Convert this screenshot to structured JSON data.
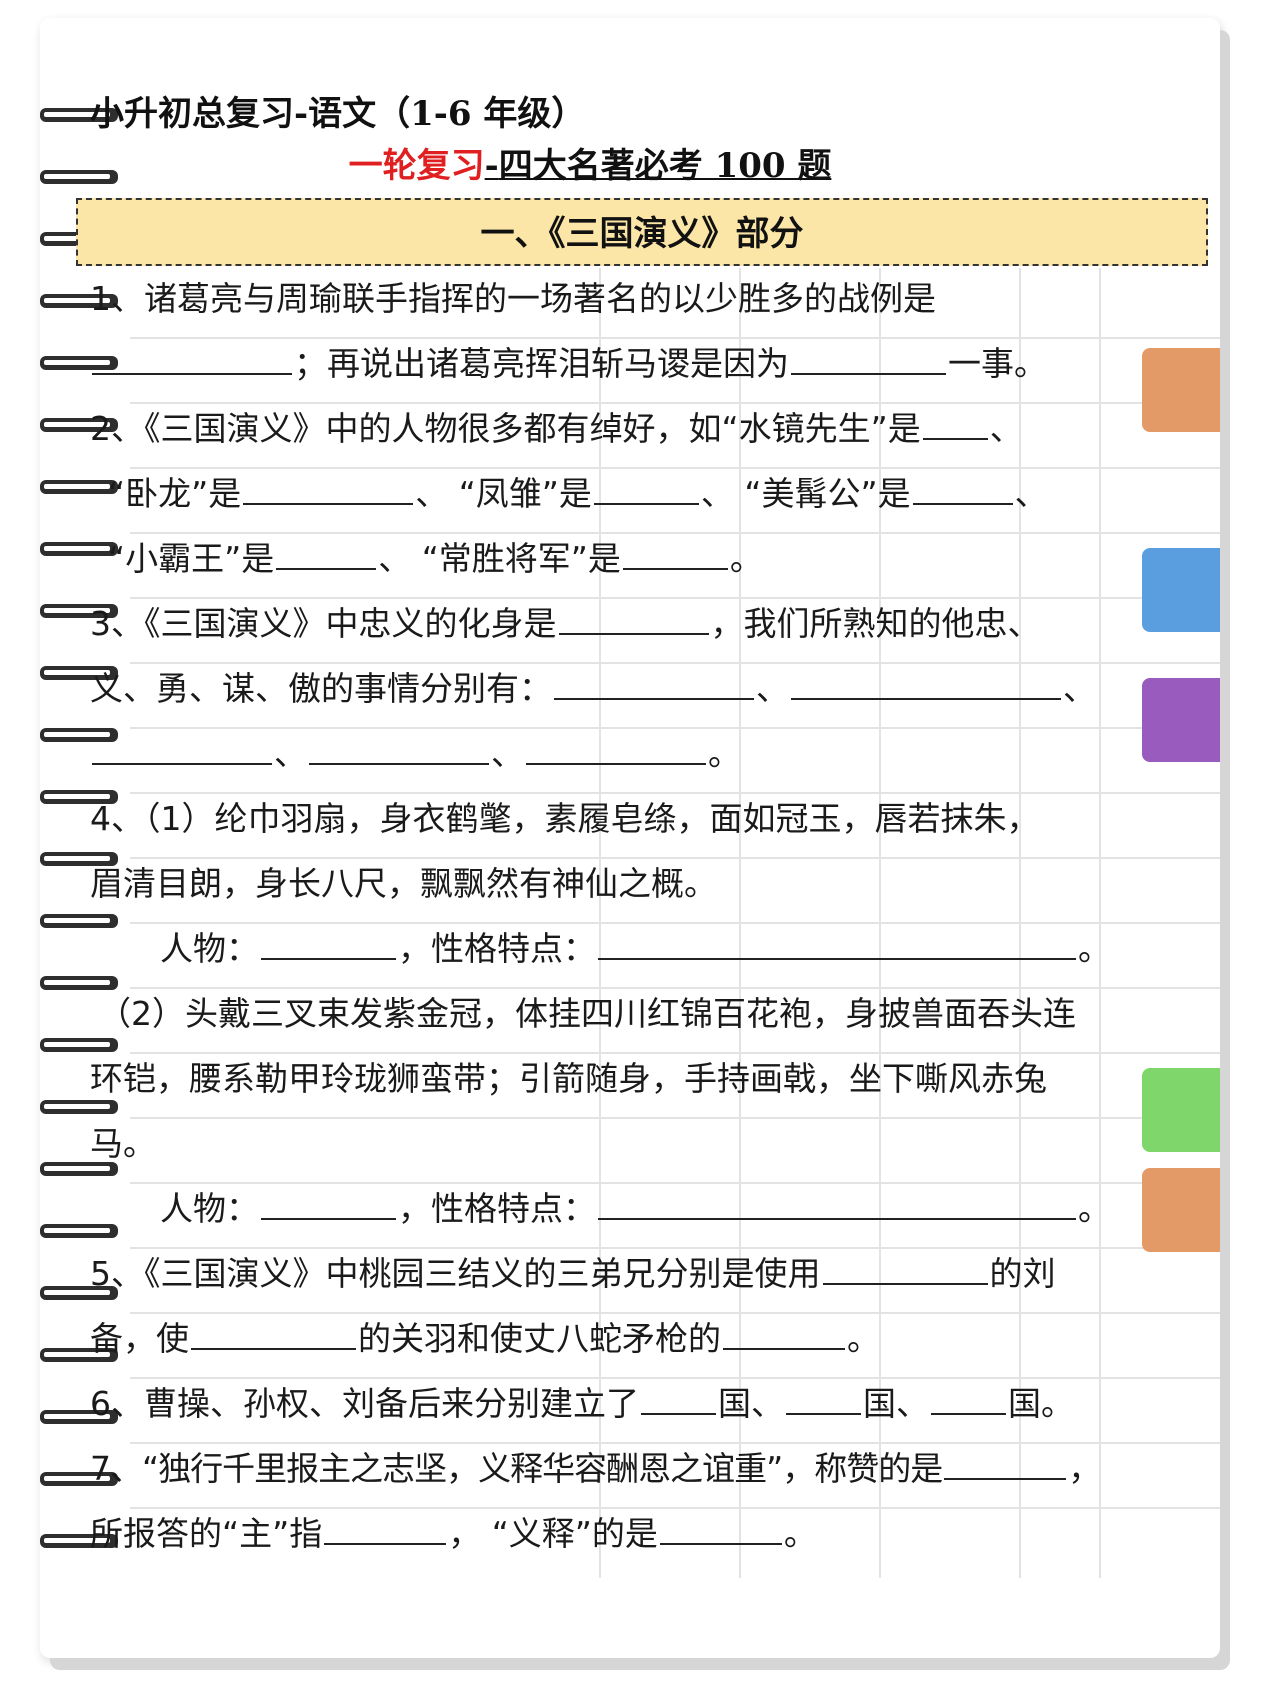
{
  "header": {
    "title": "小升初总复习-语文（1-6 年级）",
    "subtitle_red": "一轮复习",
    "subtitle_dash": "-",
    "subtitle_dark": "四大名著必考 100 题"
  },
  "section": {
    "title": "一、《三国演义》部分"
  },
  "questions": {
    "q1": {
      "a": "1、诸葛亮与周瑜联手指挥的一场著名的以少胜多的战例是",
      "b": "；再说出诸葛亮挥泪斩马谡是因为",
      "c": "一事。"
    },
    "q2": {
      "a": "2、《三国演义》中的人物很多都有绰好，如“水镜先生”是",
      "b": "、",
      "c": "“卧龙”是",
      "d": "、 “凤雏”是",
      "e": "、 “美髯公”是",
      "f": "、",
      "g": "“小霸王”是",
      "h": "、 “常胜将军”是",
      "i": "。"
    },
    "q3": {
      "a": "3、《三国演义》中忠义的化身是",
      "b": "，我们所熟知的他忠、",
      "c": "义、勇、谋、傲的事情分别有：",
      "d": "、",
      "e": "、",
      "f": "、",
      "g": "、",
      "h": "。"
    },
    "q4": {
      "a": "4、（1）纶巾羽扇，身衣鹤氅，素履皂绦，面如冠玉，唇若抹朱，",
      "b": "眉清目朗，身长八尺，飘飘然有神仙之概。",
      "person": "人物：",
      "trait": "，性格特点：",
      "end": "。",
      "c": "（2）头戴三叉束发紫金冠，体挂四川红锦百花袍，身披兽面吞头连",
      "d": "环铠，腰系勒甲玲珑狮蛮带；引箭随身，手持画戟，坐下嘶风赤兔",
      "e": "马。"
    },
    "q5": {
      "a": "5、《三国演义》中桃园三结义的三弟兄分别是使用",
      "b": "的刘",
      "c": "备，使",
      "d": "的关羽和使丈八蛇矛枪的",
      "e": "。"
    },
    "q6": {
      "a": "6、曹操、孙权、刘备后来分别建立了",
      "b": "国、",
      "c": "国、",
      "d": "国。"
    },
    "q7": {
      "a": "7、“独行千里报主之志坚，义释华容酬恩之谊重”，称赞的是",
      "b": "，",
      "c": "所报答的“主”指",
      "d": "，  “义释”的是",
      "e": "。"
    }
  },
  "colors": {
    "banner_bg": "#fbe6a8",
    "red_title": "#e02020",
    "tab_orange": "#e39a66",
    "tab_blue": "#5b9ee0",
    "tab_purple": "#9a5bbf",
    "tab_green": "#7fd66a"
  }
}
